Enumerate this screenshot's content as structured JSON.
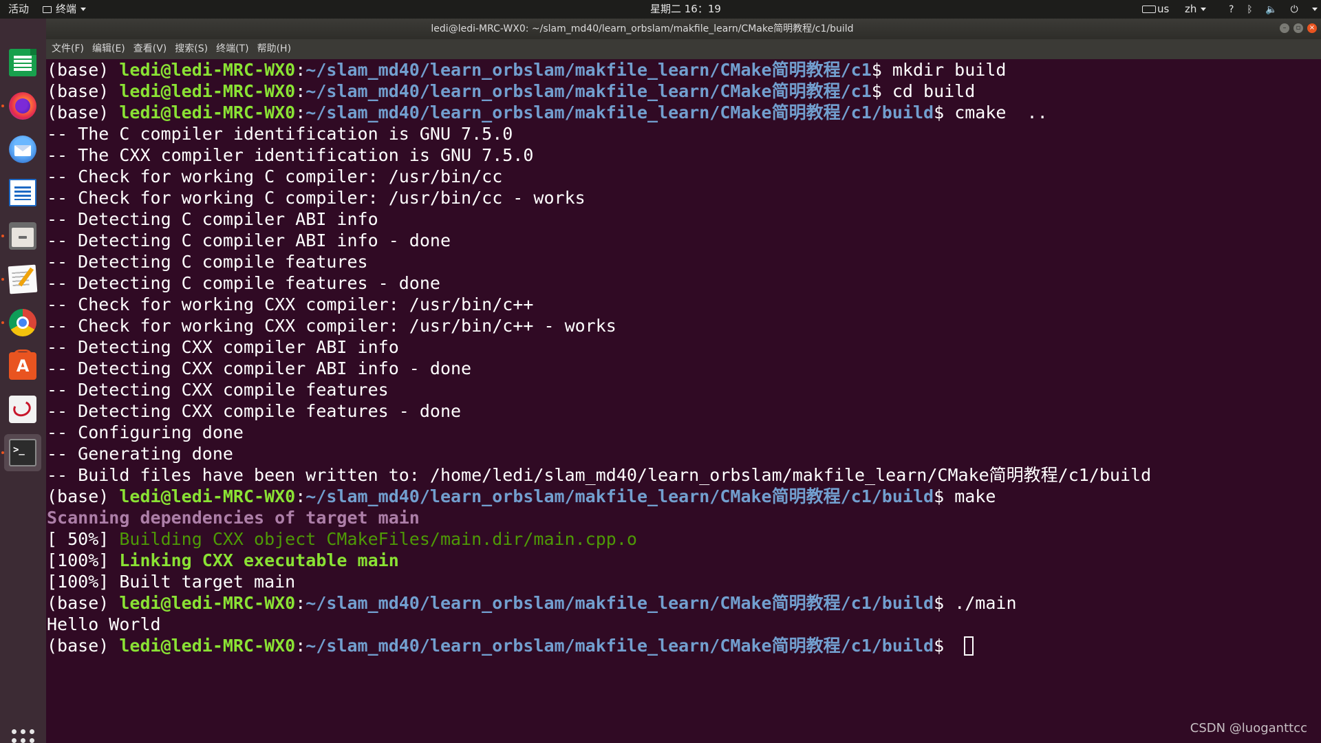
{
  "topbar": {
    "activities": "活动",
    "app_menu": "终端",
    "clock": "星期二 16：19",
    "keyboard_layout": "us",
    "input_method": "zh",
    "help_glyph": "?",
    "bluetooth_glyph": "ᛒ",
    "volume_glyph": "🔈",
    "power_glyph": "⏻"
  },
  "window": {
    "title": "ledi@ledi-MRC-WX0: ~/slam_md40/learn_orbslam/makfile_learn/CMake简明教程/c1/build",
    "controls": {
      "minimize": "–",
      "maximize": "▫",
      "close": "×"
    }
  },
  "menubar": {
    "items": [
      "文件(F)",
      "编辑(E)",
      "查看(V)",
      "搜索(S)",
      "终端(T)",
      "帮助(H)"
    ]
  },
  "dock": {
    "items": [
      {
        "name": "LibreOffice Calc",
        "icon": "spreadsheet-icon",
        "running": false
      },
      {
        "name": "Firefox",
        "icon": "firefox-icon",
        "running": true
      },
      {
        "name": "Thunderbird",
        "icon": "mail-icon",
        "running": false
      },
      {
        "name": "LibreOffice Writer",
        "icon": "document-icon",
        "running": false
      },
      {
        "name": "Files",
        "icon": "files-icon",
        "running": true
      },
      {
        "name": "Text Editor",
        "icon": "text-editor-icon",
        "running": true
      },
      {
        "name": "Chrome",
        "icon": "chrome-icon",
        "running": true
      },
      {
        "name": "Ubuntu Software",
        "icon": "software-store-icon",
        "running": false
      },
      {
        "name": "Document Viewer",
        "icon": "pdf-viewer-icon",
        "running": false
      },
      {
        "name": "Terminal",
        "icon": "terminal-icon",
        "running": true,
        "active": true
      }
    ],
    "show_apps_icon": "app-grid-icon"
  },
  "terminal": {
    "prompt": {
      "env": "(base) ",
      "user_host": "ledi@ledi-MRC-WX0",
      "colon": ":",
      "dollar": "$ "
    },
    "lines": [
      {
        "kind": "prompt",
        "path": "~/slam_md40/learn_orbslam/makfile_learn/CMake简明教程/c1",
        "command": "mkdir build"
      },
      {
        "kind": "prompt",
        "path": "~/slam_md40/learn_orbslam/makfile_learn/CMake简明教程/c1",
        "command": "cd build"
      },
      {
        "kind": "prompt",
        "path": "~/slam_md40/learn_orbslam/makfile_learn/CMake简明教程/c1/build",
        "command": "cmake  .."
      },
      {
        "kind": "out",
        "text": "-- The C compiler identification is GNU 7.5.0"
      },
      {
        "kind": "out",
        "text": "-- The CXX compiler identification is GNU 7.5.0"
      },
      {
        "kind": "out",
        "text": "-- Check for working C compiler: /usr/bin/cc"
      },
      {
        "kind": "out",
        "text": "-- Check for working C compiler: /usr/bin/cc - works"
      },
      {
        "kind": "out",
        "text": "-- Detecting C compiler ABI info"
      },
      {
        "kind": "out",
        "text": "-- Detecting C compiler ABI info - done"
      },
      {
        "kind": "out",
        "text": "-- Detecting C compile features"
      },
      {
        "kind": "out",
        "text": "-- Detecting C compile features - done"
      },
      {
        "kind": "out",
        "text": "-- Check for working CXX compiler: /usr/bin/c++"
      },
      {
        "kind": "out",
        "text": "-- Check for working CXX compiler: /usr/bin/c++ - works"
      },
      {
        "kind": "out",
        "text": "-- Detecting CXX compiler ABI info"
      },
      {
        "kind": "out",
        "text": "-- Detecting CXX compiler ABI info - done"
      },
      {
        "kind": "out",
        "text": "-- Detecting CXX compile features"
      },
      {
        "kind": "out",
        "text": "-- Detecting CXX compile features - done"
      },
      {
        "kind": "out",
        "text": "-- Configuring done"
      },
      {
        "kind": "out",
        "text": "-- Generating done"
      },
      {
        "kind": "out",
        "text": "-- Build files have been written to: /home/ledi/slam_md40/learn_orbslam/makfile_learn/CMake简明教程/c1/build"
      },
      {
        "kind": "prompt",
        "path": "~/slam_md40/learn_orbslam/makfile_learn/CMake简明教程/c1/build",
        "command": "make"
      },
      {
        "kind": "out-magenta",
        "text": "Scanning dependencies of target main"
      },
      {
        "kind": "progress",
        "prefix": "[ 50%] ",
        "text": "Building CXX object CMakeFiles/main.dir/main.cpp.o",
        "style": "out-green"
      },
      {
        "kind": "progress",
        "prefix": "[100%] ",
        "text": "Linking CXX executable main",
        "style": "out-bold-green"
      },
      {
        "kind": "out",
        "text": "[100%] Built target main"
      },
      {
        "kind": "prompt",
        "path": "~/slam_md40/learn_orbslam/makfile_learn/CMake简明教程/c1/build",
        "command": "./main"
      },
      {
        "kind": "out",
        "text": "Hello World"
      },
      {
        "kind": "prompt",
        "path": "~/slam_md40/learn_orbslam/makfile_learn/CMake简明教程/c1/build",
        "command": "",
        "cursor": true
      }
    ]
  },
  "watermark": "CSDN @luoganttcc",
  "colors": {
    "terminal_bg": "#300a24",
    "prompt_user": "#8ae234",
    "prompt_path": "#729fcf",
    "make_scan": "#ad7fa8",
    "make_build": "#4e9a06",
    "accent": "#e95420"
  }
}
